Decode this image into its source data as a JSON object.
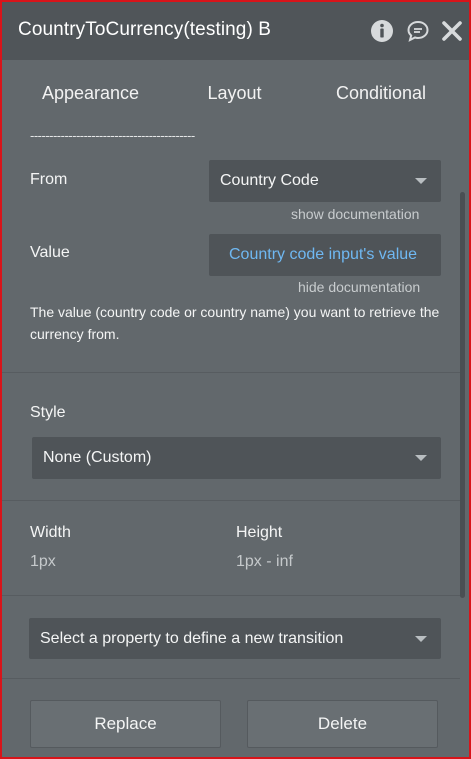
{
  "window": {
    "title": "CountryToCurrency(testing) B"
  },
  "tabs": [
    {
      "label": "Appearance",
      "active": true
    },
    {
      "label": "Layout",
      "active": false
    },
    {
      "label": "Conditional",
      "active": false
    }
  ],
  "content": {
    "separator_text": "-------------------------------------------",
    "from": {
      "label": "From",
      "selected": "Country Code",
      "doc_link": "show documentation"
    },
    "value": {
      "label": "Value",
      "expression": "Country code input's value",
      "doc_link": "hide documentation",
      "description": "The value (country code or country name) you want to retrieve the currency from."
    },
    "style": {
      "label": "Style",
      "selected": "None (Custom)"
    },
    "size": {
      "width_label": "Width",
      "width_value": "1px",
      "height_label": "Height",
      "height_value": "1px - inf"
    },
    "transition": {
      "placeholder": "Select a property to define a new transition"
    },
    "buttons": {
      "replace": "Replace",
      "delete": "Delete"
    }
  },
  "colors": {
    "panel_bg": "#62686c",
    "titlebar_bg": "#505559",
    "field_bg": "#4f5458",
    "link_blue": "#6fb8f2",
    "border_red": "#d8141a"
  },
  "icons": [
    "info-icon",
    "comment-icon",
    "close-icon",
    "chevron-down-icon"
  ]
}
